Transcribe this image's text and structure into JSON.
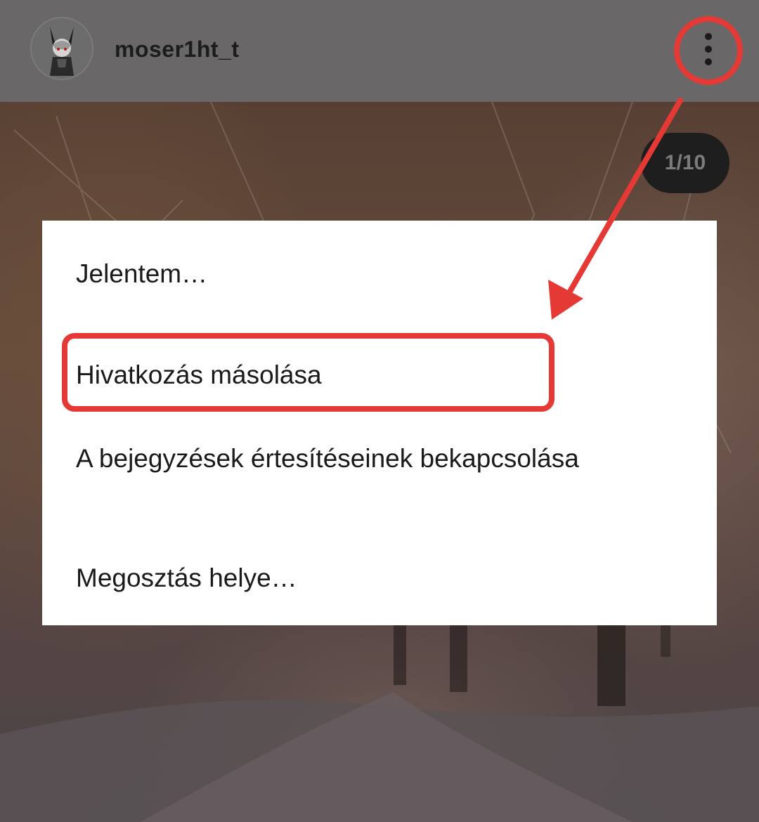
{
  "header": {
    "username": "moser1ht_t",
    "avatar_icon": "avatar-character-icon",
    "more_icon": "more-vertical-icon"
  },
  "post": {
    "counter": "1/10"
  },
  "menu": {
    "items": [
      {
        "label": "Jelentem…"
      },
      {
        "label": "Hivatkozás másolása"
      },
      {
        "label": "A bejegyzések értesítéseinek bekapcsolása"
      },
      {
        "label": "Megosztás helye…"
      }
    ]
  },
  "colors": {
    "annotation": "#e53935",
    "header_bg": "#696767",
    "menu_bg": "#ffffff",
    "counter_bg": "#1e1e1e"
  }
}
